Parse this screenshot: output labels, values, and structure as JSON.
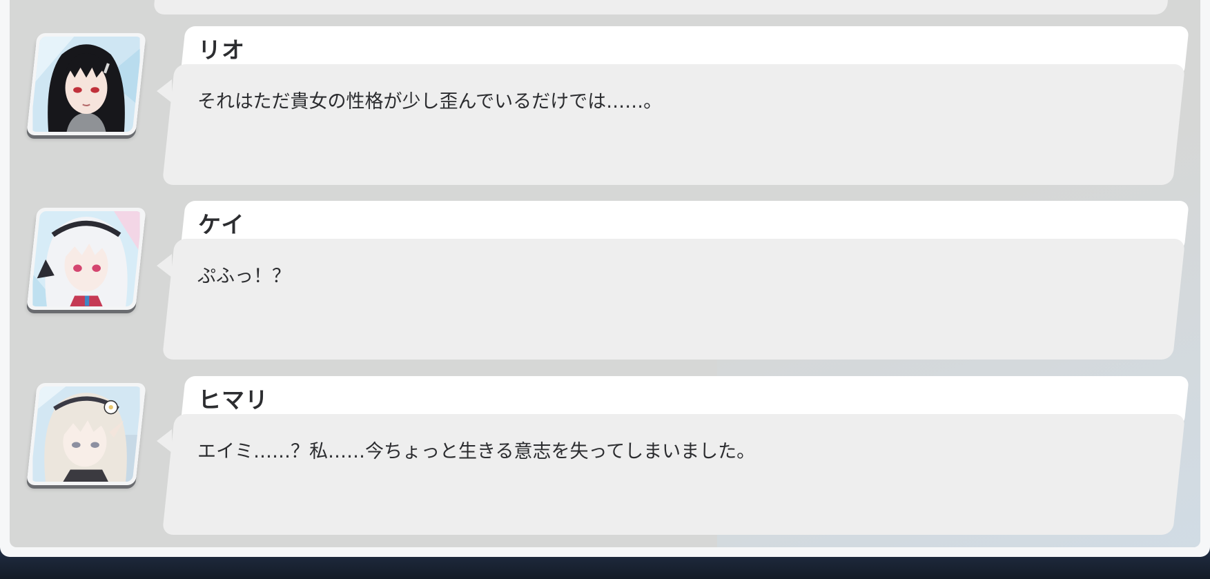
{
  "dialogue_log": {
    "entries": [
      {
        "speaker": "リオ",
        "message": "それはただ貴女の性格が少し歪んでいるだけでは……。",
        "avatar_icon": "rio-portrait-icon"
      },
      {
        "speaker": "ケイ",
        "message": "ぷふっ！？",
        "avatar_icon": "kei-portrait-icon"
      },
      {
        "speaker": "ヒマリ",
        "message": "エイミ……？私……今ちょっと生きる意志を失ってしまいました。",
        "avatar_icon": "himari-portrait-icon"
      }
    ]
  },
  "colors": {
    "panel_bg": "#d6d7d6",
    "name_plate": "#ffffff",
    "bubble": "#eeeeee",
    "text": "#2c2d30",
    "backdrop": "#1c2433"
  }
}
